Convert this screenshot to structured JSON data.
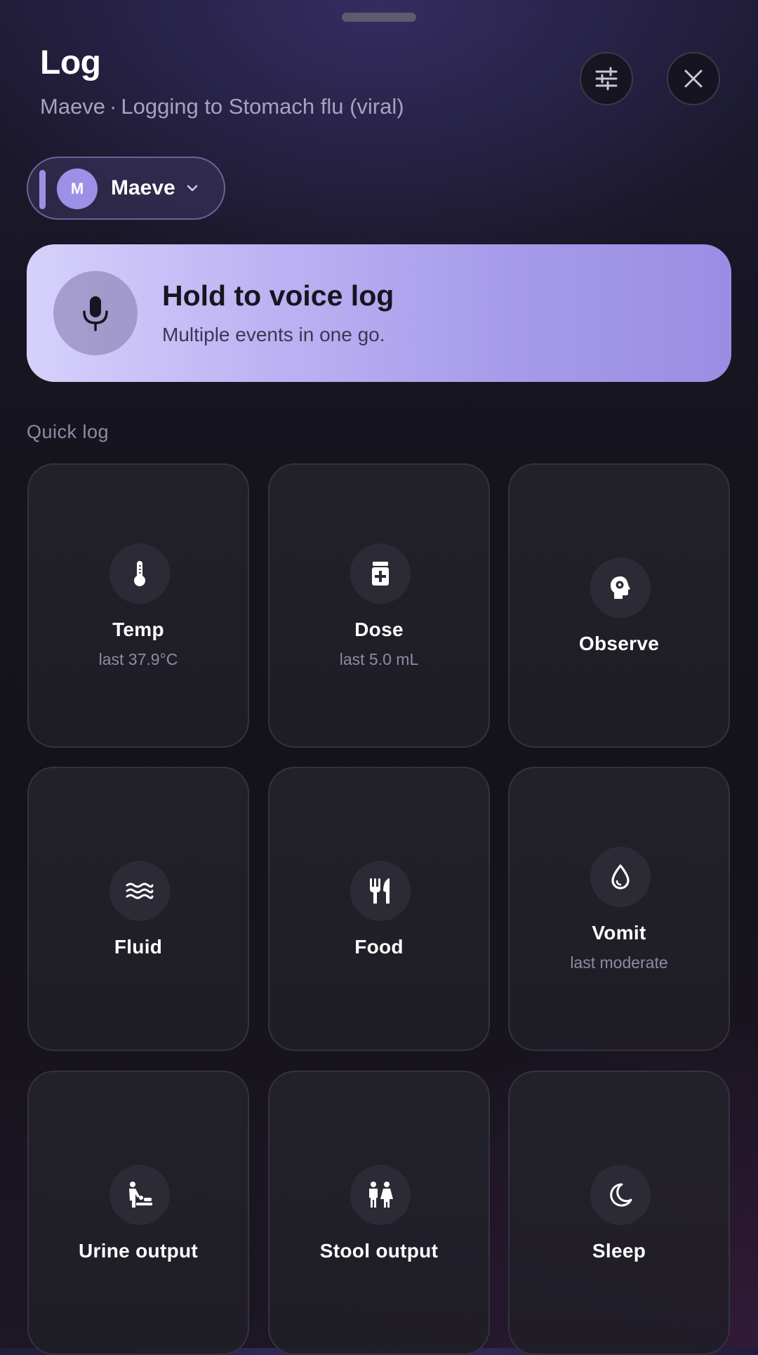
{
  "header": {
    "title": "Log",
    "patient": "Maeve",
    "separator": "·",
    "logging_to": "Logging to Stomach flu (viral)",
    "filter_icon": "sliders-icon",
    "close_icon": "close-icon"
  },
  "person_selector": {
    "initial": "M",
    "name": "Maeve",
    "accent": "#9b8fe6"
  },
  "voice_log": {
    "title": "Hold to voice log",
    "subtitle": "Multiple events in one go.",
    "icon": "microphone-icon"
  },
  "quick_log": {
    "label": "Quick log",
    "tiles": [
      {
        "label": "Temp",
        "sub": "last 37.9°C",
        "icon": "thermometer-icon"
      },
      {
        "label": "Dose",
        "sub": "last 5.0 mL",
        "icon": "medicine-bottle-icon"
      },
      {
        "label": "Observe",
        "sub": "",
        "icon": "head-cog-icon"
      },
      {
        "label": "Fluid",
        "sub": "",
        "icon": "water-waves-icon"
      },
      {
        "label": "Food",
        "sub": "",
        "icon": "fork-knife-icon"
      },
      {
        "label": "Vomit",
        "sub": "last moderate",
        "icon": "droplet-icon"
      },
      {
        "label": "Urine output",
        "sub": "",
        "icon": "baby-changing-icon"
      },
      {
        "label": "Stool output",
        "sub": "",
        "icon": "restroom-icon"
      },
      {
        "label": "Sleep",
        "sub": "",
        "icon": "moon-icon"
      }
    ]
  }
}
